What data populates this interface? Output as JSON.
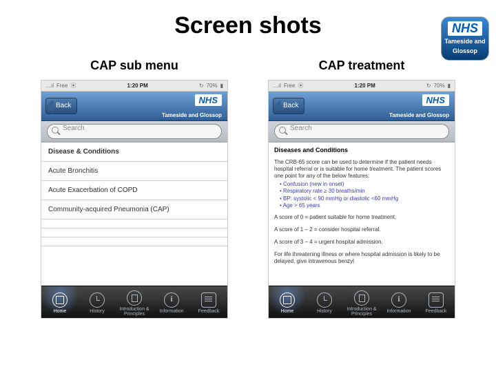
{
  "slide": {
    "title": "Screen shots"
  },
  "logo": {
    "nhs": "NHS",
    "sub1": "Tameside and",
    "sub2": "Glossop"
  },
  "captions": {
    "left": "CAP sub menu",
    "right": "CAP treatment"
  },
  "status": {
    "signal": "…ıl",
    "carrier": "Free",
    "wifi": "⦿",
    "time": "1:20 PM",
    "refresh": "↻",
    "battery_pct": "70%",
    "battery": "▮"
  },
  "nav": {
    "back": "Back",
    "brand": "NHS",
    "subtitle": "Tameside and Glossop"
  },
  "search": {
    "placeholder": "Search"
  },
  "left_list": {
    "header": "Disease & Conditions",
    "items": [
      "Acute Bronchitis",
      "Acute Exacerbation of COPD",
      "Community-acquired Pneumonia (CAP)"
    ]
  },
  "right_detail": {
    "header": "Diseases and Conditions",
    "para1": "The CRB-65 score can be used to determine if the patient needs hospital referral or is suitable for home treatment. The patient scores one point for any of the below features:",
    "bullets": [
      "Confusion (new in onset)",
      "Respiratory rate ≥ 30 breaths/min",
      "BP: systolic < 90 mmHg or diastolic <60 mmHg",
      "Age > 65 years"
    ],
    "score_lines": [
      "A score of    0 =      patient suitable for home treatment.",
      "A score of 1 – 2 =   consider hospital referral.",
      "A score of 3 – 4 =   urgent hospital admission."
    ],
    "para2": "For life threatening illness or where hospital admission is likely to be delayed, give intravenous benzyl"
  },
  "tabs": [
    {
      "label": "Home"
    },
    {
      "label": "History"
    },
    {
      "label": "Introduction & Principles"
    },
    {
      "label": "Information"
    },
    {
      "label": "Feedback"
    }
  ]
}
